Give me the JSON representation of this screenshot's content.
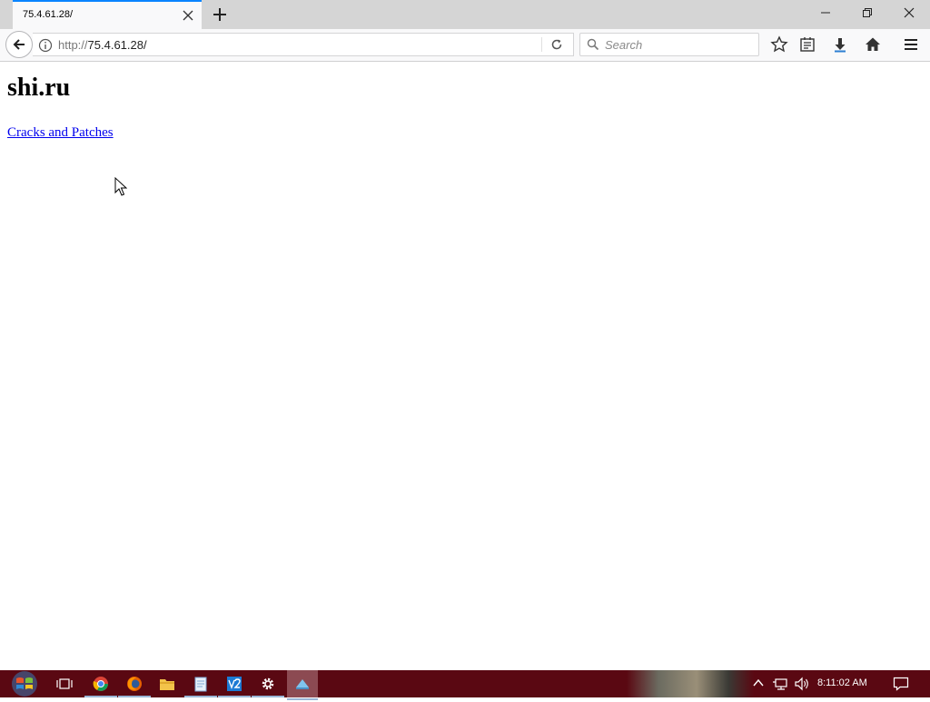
{
  "browser": {
    "tab": {
      "title": "75.4.61.28/"
    },
    "url_prefix": "http://",
    "url_host": "75.4.61.28/",
    "search_placeholder": "Search"
  },
  "page": {
    "heading": "shi.ru",
    "link": "Cracks and Patches"
  },
  "taskbar": {
    "clock": "8:11:02 AM"
  },
  "colors": {
    "link": "#0000ee",
    "tab_accent": "#0a84ff",
    "taskbar": "#5a0812",
    "download_arrow": "#2d7fd3"
  }
}
